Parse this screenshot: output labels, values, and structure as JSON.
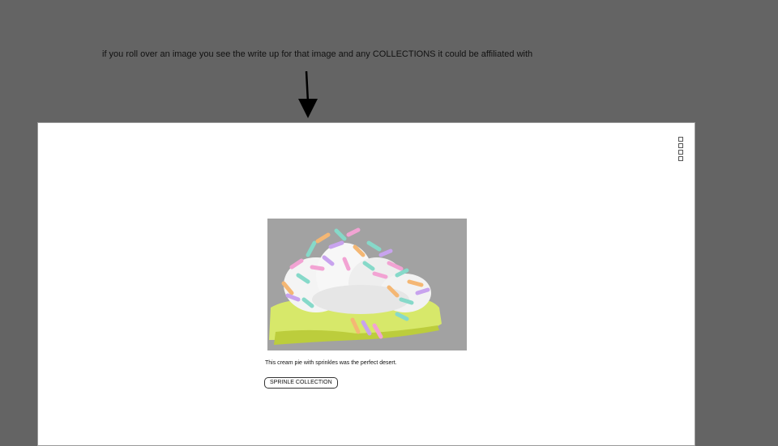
{
  "annotation": {
    "text": "if you roll over an image you see the write up for that image and any COLLECTIONS it could be affiliated with"
  },
  "page": {
    "menu_icon": "hamburger-menu-icon",
    "image": {
      "caption": "This cream pie with sprinkles was the perfect desert."
    },
    "collection_button": {
      "label": "SPRINLE COLLECTION"
    }
  },
  "colors": {
    "outer_background": "#646464",
    "page_background": "#ffffff",
    "image_background": "#a2a2a2",
    "pie_crust": "#d7e86a",
    "cream": "#f4f4f4"
  }
}
